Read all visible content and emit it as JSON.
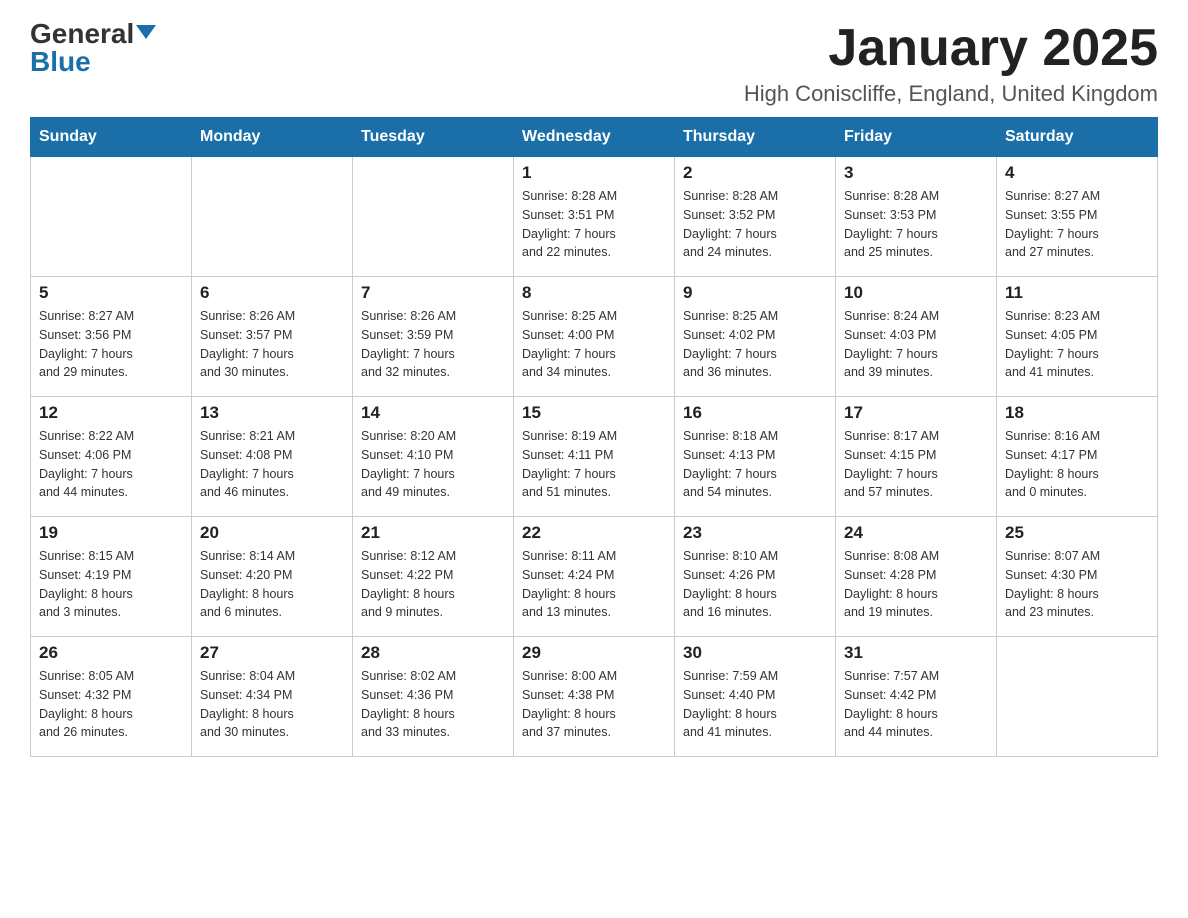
{
  "header": {
    "logo_general": "General",
    "logo_blue": "Blue",
    "month_title": "January 2025",
    "location": "High Coniscliffe, England, United Kingdom"
  },
  "weekdays": [
    "Sunday",
    "Monday",
    "Tuesday",
    "Wednesday",
    "Thursday",
    "Friday",
    "Saturday"
  ],
  "weeks": [
    [
      {
        "day": "",
        "info": ""
      },
      {
        "day": "",
        "info": ""
      },
      {
        "day": "",
        "info": ""
      },
      {
        "day": "1",
        "info": "Sunrise: 8:28 AM\nSunset: 3:51 PM\nDaylight: 7 hours\nand 22 minutes."
      },
      {
        "day": "2",
        "info": "Sunrise: 8:28 AM\nSunset: 3:52 PM\nDaylight: 7 hours\nand 24 minutes."
      },
      {
        "day": "3",
        "info": "Sunrise: 8:28 AM\nSunset: 3:53 PM\nDaylight: 7 hours\nand 25 minutes."
      },
      {
        "day": "4",
        "info": "Sunrise: 8:27 AM\nSunset: 3:55 PM\nDaylight: 7 hours\nand 27 minutes."
      }
    ],
    [
      {
        "day": "5",
        "info": "Sunrise: 8:27 AM\nSunset: 3:56 PM\nDaylight: 7 hours\nand 29 minutes."
      },
      {
        "day": "6",
        "info": "Sunrise: 8:26 AM\nSunset: 3:57 PM\nDaylight: 7 hours\nand 30 minutes."
      },
      {
        "day": "7",
        "info": "Sunrise: 8:26 AM\nSunset: 3:59 PM\nDaylight: 7 hours\nand 32 minutes."
      },
      {
        "day": "8",
        "info": "Sunrise: 8:25 AM\nSunset: 4:00 PM\nDaylight: 7 hours\nand 34 minutes."
      },
      {
        "day": "9",
        "info": "Sunrise: 8:25 AM\nSunset: 4:02 PM\nDaylight: 7 hours\nand 36 minutes."
      },
      {
        "day": "10",
        "info": "Sunrise: 8:24 AM\nSunset: 4:03 PM\nDaylight: 7 hours\nand 39 minutes."
      },
      {
        "day": "11",
        "info": "Sunrise: 8:23 AM\nSunset: 4:05 PM\nDaylight: 7 hours\nand 41 minutes."
      }
    ],
    [
      {
        "day": "12",
        "info": "Sunrise: 8:22 AM\nSunset: 4:06 PM\nDaylight: 7 hours\nand 44 minutes."
      },
      {
        "day": "13",
        "info": "Sunrise: 8:21 AM\nSunset: 4:08 PM\nDaylight: 7 hours\nand 46 minutes."
      },
      {
        "day": "14",
        "info": "Sunrise: 8:20 AM\nSunset: 4:10 PM\nDaylight: 7 hours\nand 49 minutes."
      },
      {
        "day": "15",
        "info": "Sunrise: 8:19 AM\nSunset: 4:11 PM\nDaylight: 7 hours\nand 51 minutes."
      },
      {
        "day": "16",
        "info": "Sunrise: 8:18 AM\nSunset: 4:13 PM\nDaylight: 7 hours\nand 54 minutes."
      },
      {
        "day": "17",
        "info": "Sunrise: 8:17 AM\nSunset: 4:15 PM\nDaylight: 7 hours\nand 57 minutes."
      },
      {
        "day": "18",
        "info": "Sunrise: 8:16 AM\nSunset: 4:17 PM\nDaylight: 8 hours\nand 0 minutes."
      }
    ],
    [
      {
        "day": "19",
        "info": "Sunrise: 8:15 AM\nSunset: 4:19 PM\nDaylight: 8 hours\nand 3 minutes."
      },
      {
        "day": "20",
        "info": "Sunrise: 8:14 AM\nSunset: 4:20 PM\nDaylight: 8 hours\nand 6 minutes."
      },
      {
        "day": "21",
        "info": "Sunrise: 8:12 AM\nSunset: 4:22 PM\nDaylight: 8 hours\nand 9 minutes."
      },
      {
        "day": "22",
        "info": "Sunrise: 8:11 AM\nSunset: 4:24 PM\nDaylight: 8 hours\nand 13 minutes."
      },
      {
        "day": "23",
        "info": "Sunrise: 8:10 AM\nSunset: 4:26 PM\nDaylight: 8 hours\nand 16 minutes."
      },
      {
        "day": "24",
        "info": "Sunrise: 8:08 AM\nSunset: 4:28 PM\nDaylight: 8 hours\nand 19 minutes."
      },
      {
        "day": "25",
        "info": "Sunrise: 8:07 AM\nSunset: 4:30 PM\nDaylight: 8 hours\nand 23 minutes."
      }
    ],
    [
      {
        "day": "26",
        "info": "Sunrise: 8:05 AM\nSunset: 4:32 PM\nDaylight: 8 hours\nand 26 minutes."
      },
      {
        "day": "27",
        "info": "Sunrise: 8:04 AM\nSunset: 4:34 PM\nDaylight: 8 hours\nand 30 minutes."
      },
      {
        "day": "28",
        "info": "Sunrise: 8:02 AM\nSunset: 4:36 PM\nDaylight: 8 hours\nand 33 minutes."
      },
      {
        "day": "29",
        "info": "Sunrise: 8:00 AM\nSunset: 4:38 PM\nDaylight: 8 hours\nand 37 minutes."
      },
      {
        "day": "30",
        "info": "Sunrise: 7:59 AM\nSunset: 4:40 PM\nDaylight: 8 hours\nand 41 minutes."
      },
      {
        "day": "31",
        "info": "Sunrise: 7:57 AM\nSunset: 4:42 PM\nDaylight: 8 hours\nand 44 minutes."
      },
      {
        "day": "",
        "info": ""
      }
    ]
  ]
}
